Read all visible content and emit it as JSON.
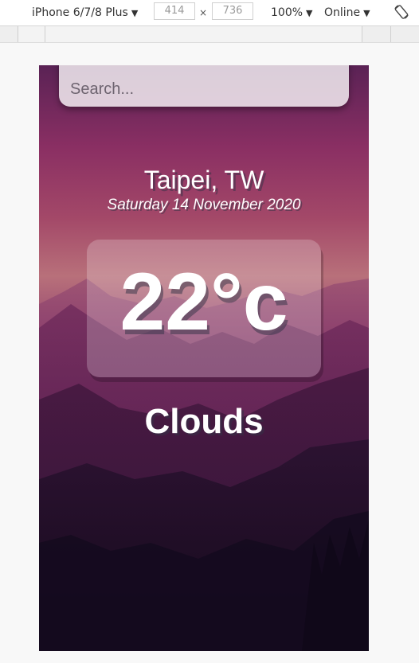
{
  "devtools": {
    "device": "iPhone 6/7/8 Plus",
    "width": "414",
    "height": "736",
    "times": "×",
    "zoom": "100%",
    "network": "Online",
    "rotate_icon": "rotate-icon"
  },
  "app": {
    "search": {
      "placeholder": "Search...",
      "value": ""
    },
    "location": "Taipei, TW",
    "date": "Saturday 14 November 2020",
    "temperature": "22°c",
    "weather": "Clouds"
  },
  "colors": {
    "sky_top": "#5a2255",
    "sky_mid": "#b8707a",
    "ground": "#140a1e"
  }
}
